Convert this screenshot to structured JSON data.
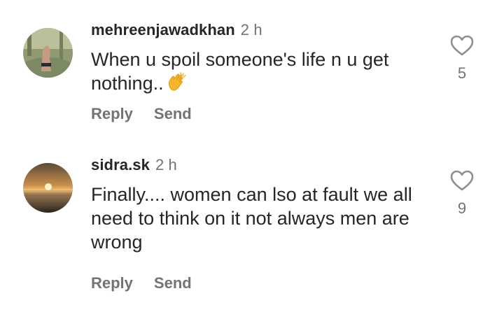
{
  "comments": [
    {
      "username": "mehreenjawadkhan",
      "time": "2 h",
      "text": "When u spoil someone's life n u get nothing..",
      "emoji": "clapping-hands-icon",
      "reply_label": "Reply",
      "send_label": "Send",
      "like_count": "5"
    },
    {
      "username": "sidra.sk",
      "time": "2 h",
      "text": "Finally.... women can lso at fault we all need to think on it not always men are wrong",
      "reply_label": "Reply",
      "send_label": "Send",
      "like_count": "9"
    }
  ],
  "colors": {
    "text": "#262626",
    "secondary": "#737373"
  }
}
